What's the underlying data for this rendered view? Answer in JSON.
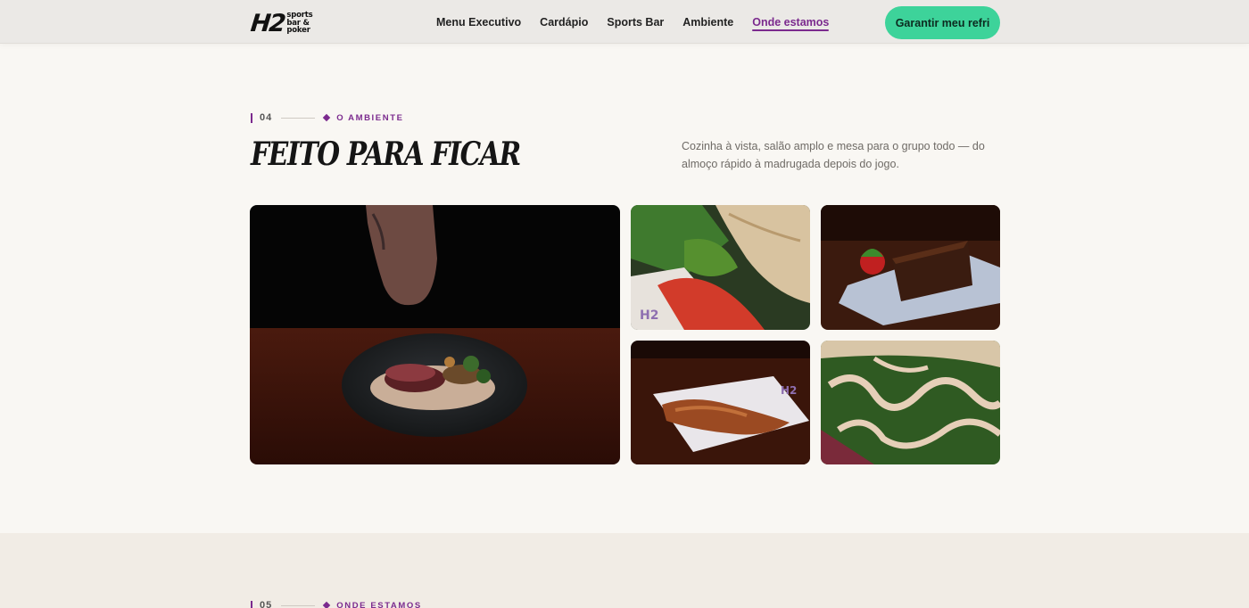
{
  "header": {
    "logo": {
      "mark": "H2",
      "words": [
        "sports",
        "bar &",
        "poker"
      ]
    },
    "nav": [
      "Menu Executivo",
      "Cardápio",
      "Sports Bar",
      "Ambiente",
      "Onde estamos"
    ],
    "active_nav": "Onde estamos",
    "cta_label": "Garantir meu refri"
  },
  "ambiente": {
    "number": "04",
    "label": "O AMBIENTE",
    "title": "FEITO PARA FICAR",
    "description": "Cozinha à vista, salão amplo e mesa para o grupo todo — do almoço rápido à madrugada depois do jogo."
  },
  "onde_estamos": {
    "number": "05",
    "label": "ONDE ESTAMOS"
  },
  "colors": {
    "accent": "#7b2a8e",
    "cta": "#3dd39a",
    "background": "#f9f7f3",
    "section_alt": "#f1ece5"
  }
}
